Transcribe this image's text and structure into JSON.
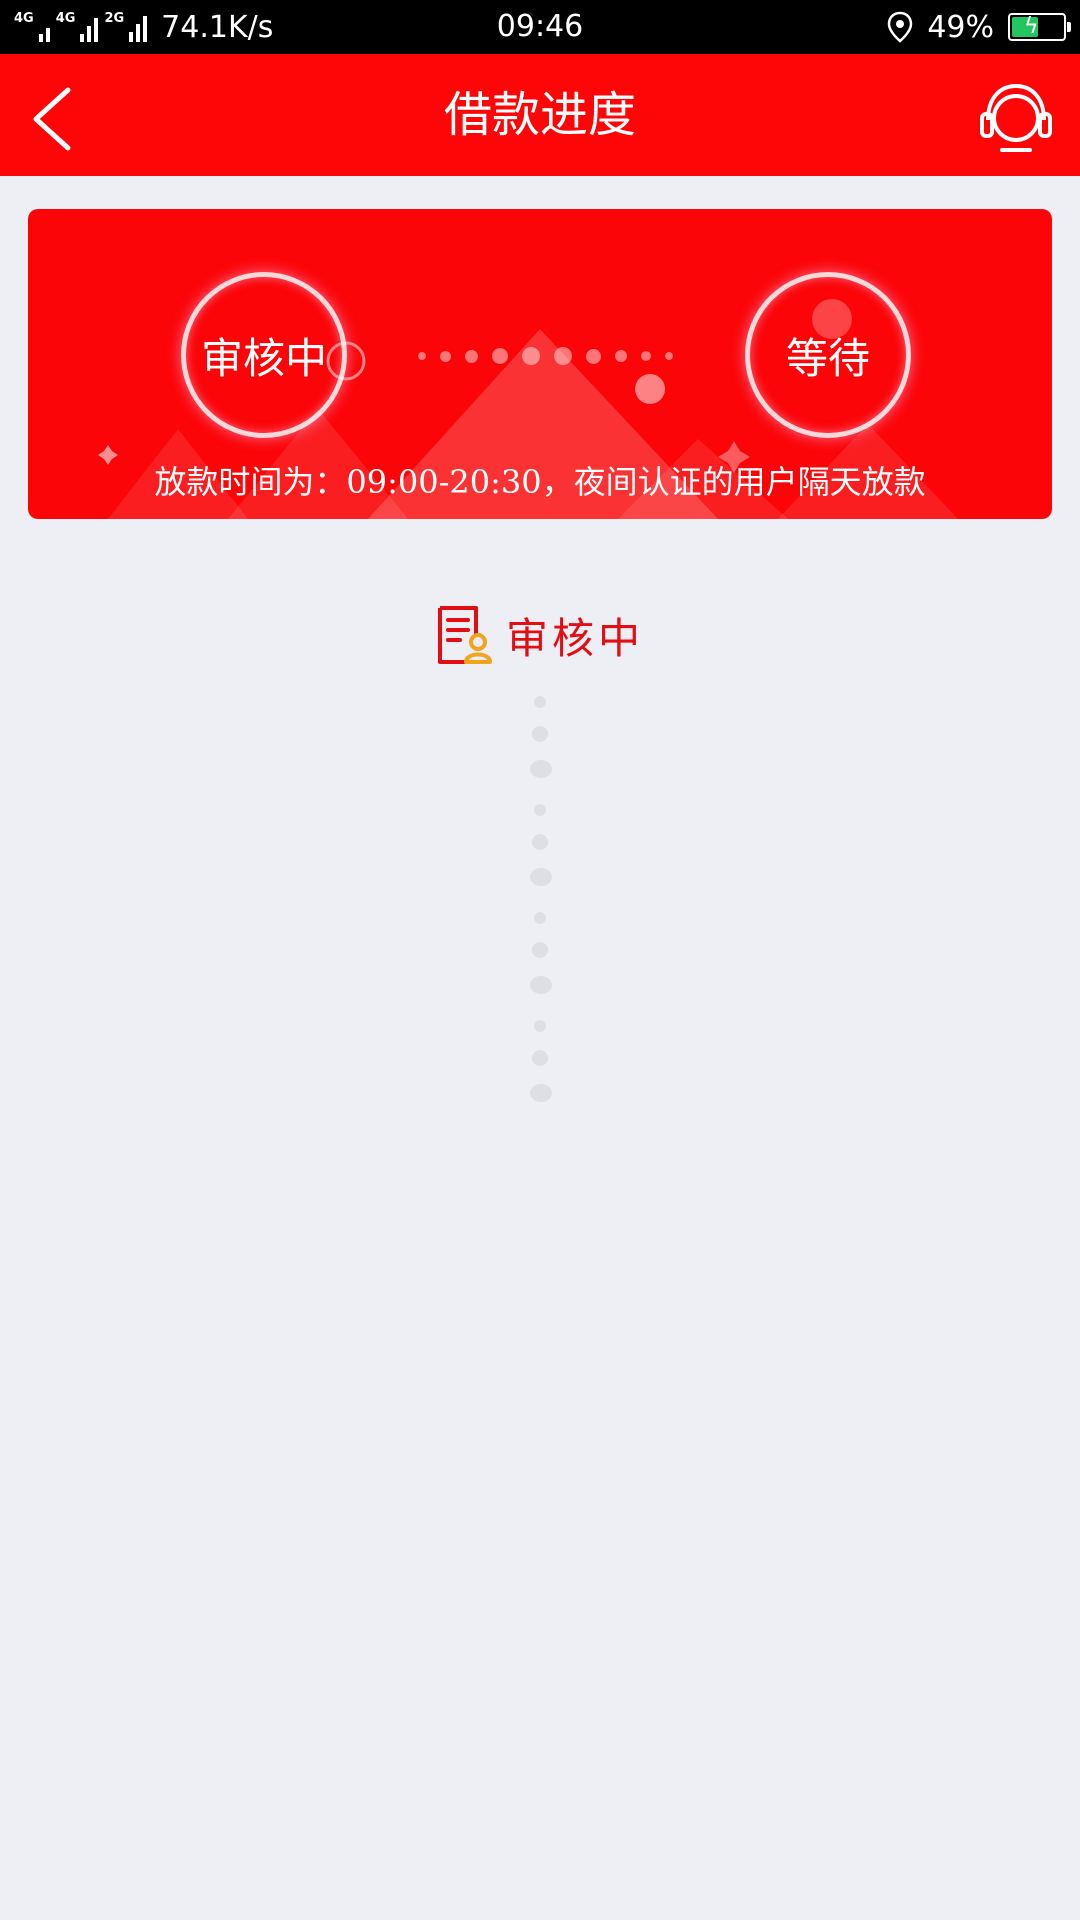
{
  "status_bar": {
    "network_left": "4G",
    "network_mid": "4G",
    "network_right": "2G",
    "speed": "74.1K/s",
    "time": "09:46",
    "battery": "49%"
  },
  "header": {
    "title": "借款进度",
    "back_icon": "chevron-left-icon",
    "support_icon": "headset-icon"
  },
  "banner": {
    "step1_label": "审核中",
    "step2_label": "等待",
    "note": "放款时间为：09:00-20:30，夜间认证的用户隔天放款"
  },
  "status": {
    "icon": "document-review-icon",
    "label": "审核中"
  },
  "colors": {
    "brand_red": "#fe0608",
    "status_red": "#e20e14",
    "background": "#eeeff4",
    "battery_green": "#22c55e"
  }
}
